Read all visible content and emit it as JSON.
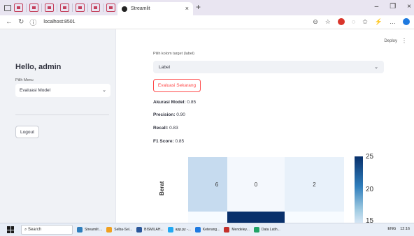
{
  "browser": {
    "active_tab_title": "Streamlit",
    "tab_close": "×",
    "new_tab": "+",
    "url": "localhost:8501",
    "window_controls": [
      "–",
      "❐",
      "×"
    ]
  },
  "sidebar": {
    "greeting": "Hello, admin",
    "menu_label": "Pilih Menu",
    "menu_value": "Evaluasi Model",
    "logout_label": "Logout"
  },
  "header": {
    "deploy_label": "Deploy",
    "menu_icon": "⋮"
  },
  "main": {
    "target_label": "Pilih kolom target (label)",
    "target_value": "Label",
    "evaluate_button": "Evaluasi Sekarang",
    "metrics": [
      {
        "name": "Akurasi Model:",
        "value": "0.85"
      },
      {
        "name": "Precision:",
        "value": "0.90"
      },
      {
        "name": "Recall:",
        "value": "0.83"
      },
      {
        "name": "F1 Score:",
        "value": "0.85"
      }
    ]
  },
  "chart_data": {
    "type": "heatmap",
    "ylabel": "Berat",
    "rows": [
      {
        "label": "Berat",
        "values": [
          6,
          0,
          2
        ]
      }
    ],
    "cells_second_row_partial": [
      null,
      null,
      null
    ],
    "colorbar_ticks": [
      "25",
      "20",
      "15"
    ],
    "colors": {
      "low": "#f7fbff",
      "mid": "#c6dbef",
      "high": "#08306b"
    }
  },
  "taskbar": {
    "search_placeholder": "Search",
    "apps": [
      "Streamlit ...",
      "Selba-Sel...",
      "BISMILAH...",
      "app.py -...",
      "Keterang...",
      "Mendeley...",
      "Data Latih..."
    ],
    "tray_lang": "ENG",
    "tray_time": "12:16"
  }
}
